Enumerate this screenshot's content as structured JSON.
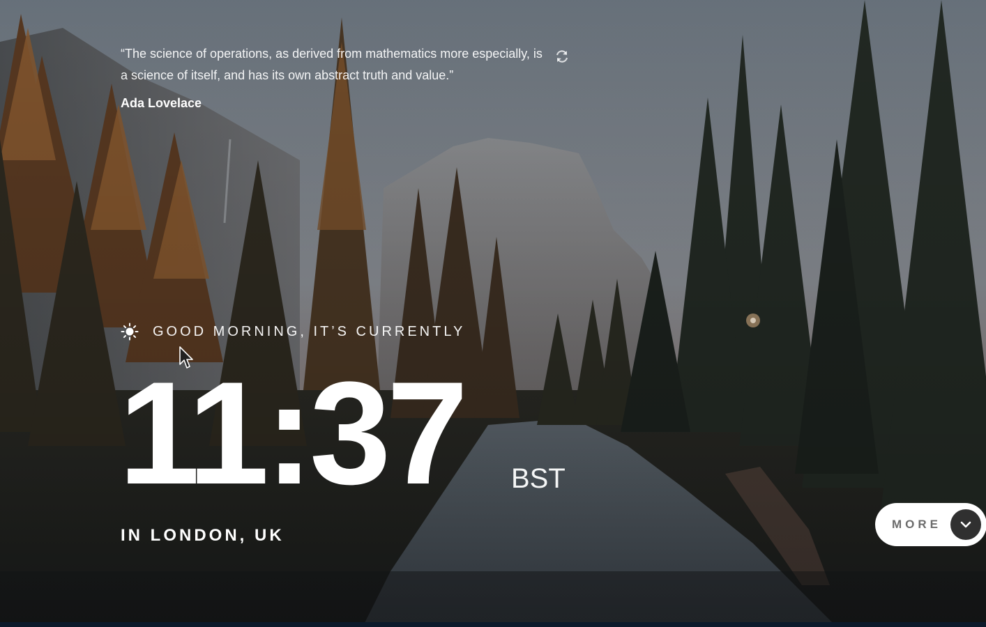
{
  "quote": {
    "text": "“The science of operations, as derived from mathematics more especially, is a science of itself, and has its own abstract truth and value.”",
    "author": "Ada Lovelace",
    "refresh_icon": "refresh-icon"
  },
  "greeting": {
    "icon": "sun-icon",
    "text": "GOOD MORNING, IT’S CURRENTLY"
  },
  "clock": {
    "time": "11:37",
    "timezone": "BST"
  },
  "location": {
    "text": "IN LONDON, UK"
  },
  "more_button": {
    "label": "MORE",
    "icon": "chevron-down-icon"
  },
  "colors": {
    "text": "#ffffff",
    "button_bg": "#ffffff",
    "button_text": "#6b6b6b",
    "chevron_bg": "#303030"
  }
}
